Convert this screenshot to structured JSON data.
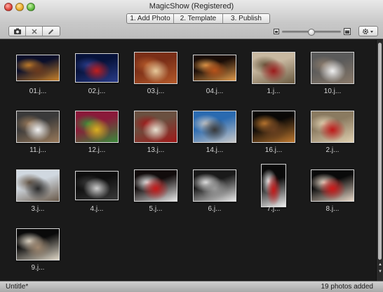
{
  "window": {
    "title": "MagicShow (Registered)"
  },
  "tabs": [
    {
      "label": "1. Add Photo",
      "active": true
    },
    {
      "label": "2. Template",
      "active": false
    },
    {
      "label": "3. Publish",
      "active": false
    }
  ],
  "toolbar": {
    "buttons": [
      {
        "icon": "add-photo-icon"
      },
      {
        "icon": "remove-icon"
      },
      {
        "icon": "edit-pencil-icon"
      }
    ],
    "zoom_level": 0.5,
    "gear_icon": "gear-icon"
  },
  "photos": [
    {
      "label": "01.j...",
      "colors": [
        "#0b0f2a",
        "#6b3a1d",
        "#c9822a"
      ]
    },
    {
      "label": "02.j...",
      "colors": [
        "#06123a",
        "#c01f1f",
        "#2a3c8a"
      ]
    },
    {
      "label": "03.j...",
      "colors": [
        "#7a2e17",
        "#e7c99a",
        "#b55a2a"
      ]
    },
    {
      "label": "04.j...",
      "colors": [
        "#1a0d07",
        "#b8531a",
        "#e09a4c"
      ]
    },
    {
      "label": "1.j...",
      "colors": [
        "#c8b8a0",
        "#9a1b1b",
        "#6a5a40"
      ]
    },
    {
      "label": "10.j...",
      "colors": [
        "#5a5a5a",
        "#f0f0f0",
        "#8a7a6a"
      ]
    },
    {
      "label": "11.j...",
      "colors": [
        "#3a3a3a",
        "#f2f2f2",
        "#9a7a5a"
      ]
    },
    {
      "label": "12.j...",
      "colors": [
        "#8a1a3a",
        "#d8b020",
        "#3a8a3a"
      ]
    },
    {
      "label": "13.j...",
      "colors": [
        "#6a5040",
        "#e8e0d0",
        "#a01818"
      ]
    },
    {
      "label": "14.j...",
      "colors": [
        "#2a6ab0",
        "#3a3a3a",
        "#c8c8c8"
      ]
    },
    {
      "label": "16.j...",
      "colors": [
        "#0a0806",
        "#6a4020",
        "#c07a30"
      ]
    },
    {
      "label": "2.j...",
      "colors": [
        "#8a7a60",
        "#c01818",
        "#e0d0b0"
      ]
    },
    {
      "label": "3.j...",
      "colors": [
        "#d0d8e0",
        "#2a2a2a",
        "#6a5a4a"
      ]
    },
    {
      "label": "4.j...",
      "colors": [
        "#0e0e0e",
        "#cfcfcf",
        "#3a3a3a"
      ]
    },
    {
      "label": "5.j...",
      "colors": [
        "#120c0c",
        "#c81a1a",
        "#e8e8e8"
      ]
    },
    {
      "label": "6.j...",
      "colors": [
        "#1a1a1a",
        "#9a9a9a",
        "#e8e8e8"
      ]
    },
    {
      "label": "7.j...",
      "colors": [
        "#0a0a0a",
        "#c81a1a",
        "#f0f0f0"
      ]
    },
    {
      "label": "8.j...",
      "colors": [
        "#0a0a0a",
        "#d01818",
        "#e8d8c8"
      ]
    },
    {
      "label": "9.j...",
      "colors": [
        "#0a0a0a",
        "#a08870",
        "#e0d8c8"
      ]
    }
  ],
  "status": {
    "document": "Untitle*",
    "count_text": "19 photos added"
  }
}
